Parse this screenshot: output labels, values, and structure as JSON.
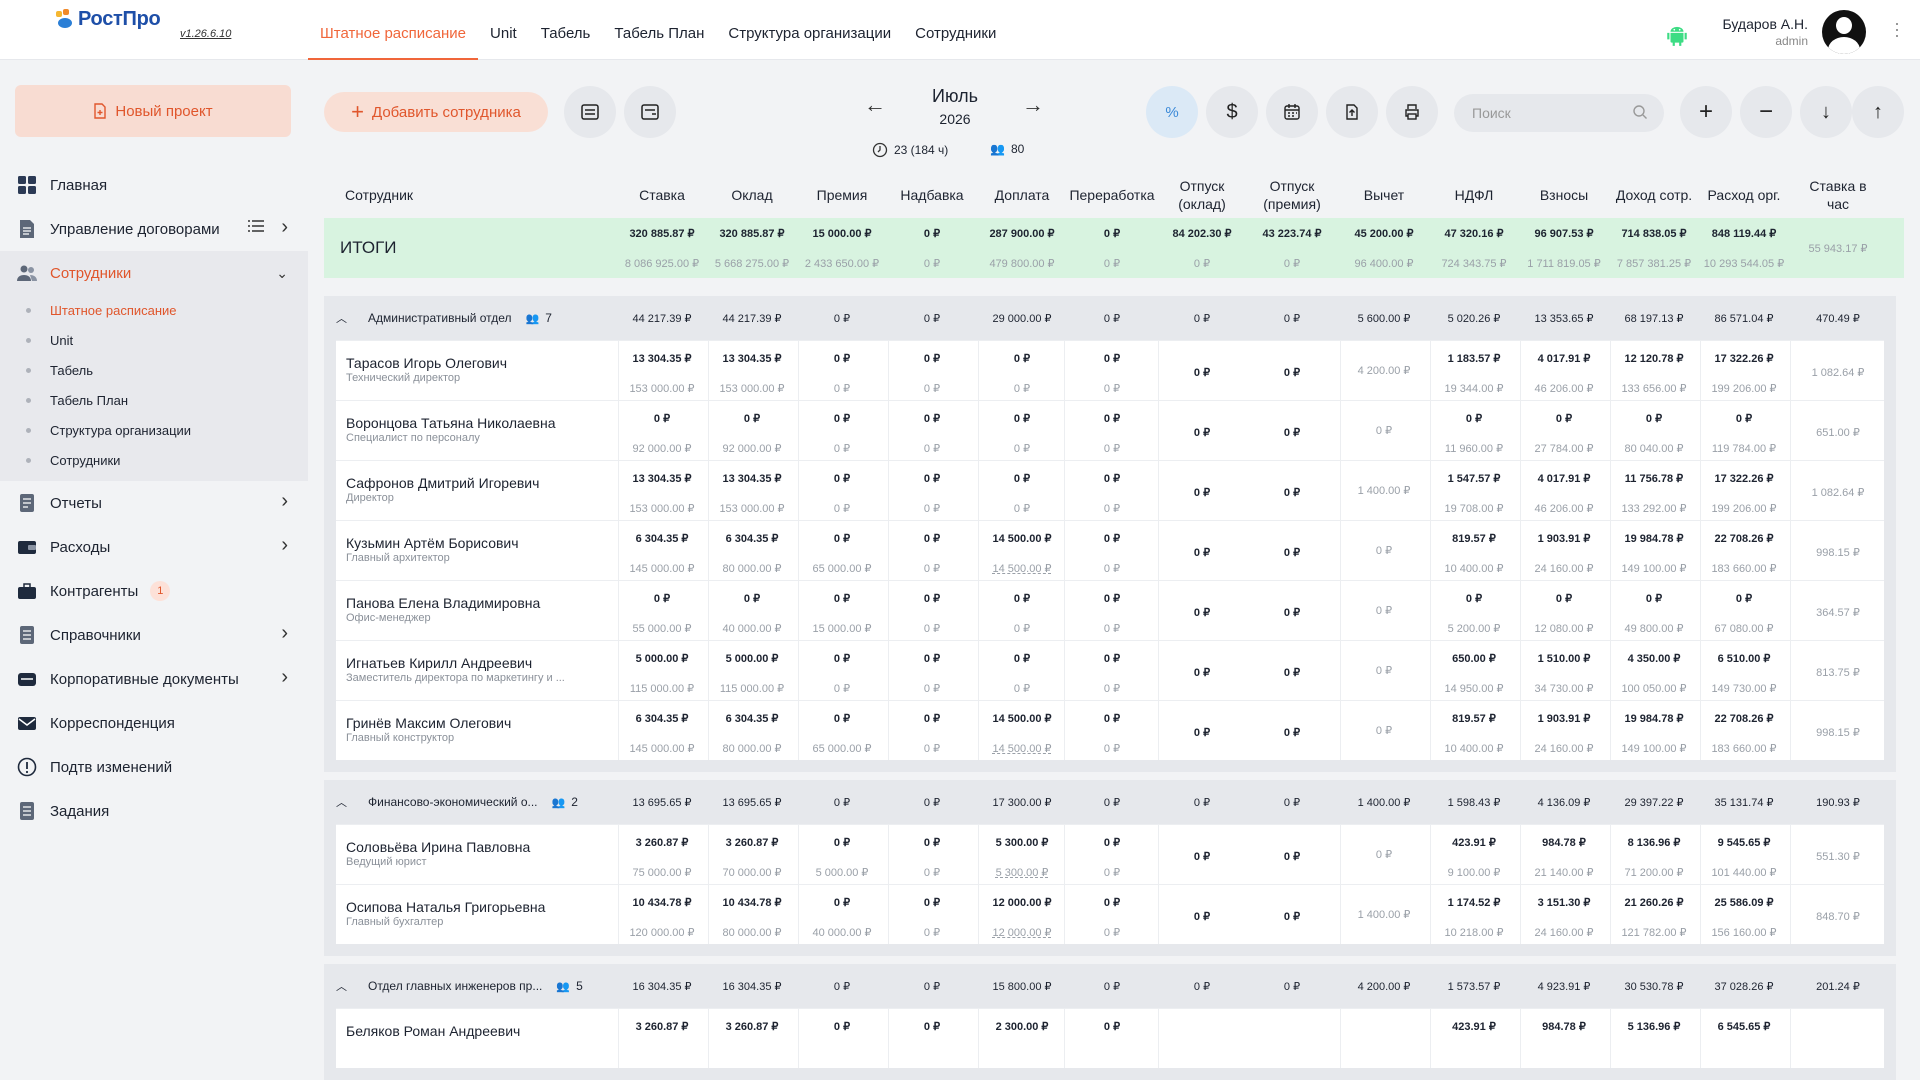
{
  "app": {
    "logo_text": "РостПро",
    "version": "v1.26.6.10"
  },
  "nav": [
    {
      "label": "Штатное расписание",
      "active": true
    },
    {
      "label": "Unit"
    },
    {
      "label": "Табель"
    },
    {
      "label": "Табель План"
    },
    {
      "label": "Структура организации"
    },
    {
      "label": "Сотрудники"
    }
  ],
  "user": {
    "name": "Бударов А.Н.",
    "role": "admin"
  },
  "sidebar": {
    "new_project": "Новый проект",
    "items": [
      {
        "label": "Главная",
        "icon": "grid-icon"
      },
      {
        "label": "Управление договорами",
        "icon": "document-icon"
      },
      {
        "label": "Сотрудники",
        "icon": "users-icon",
        "active": true
      },
      {
        "label": "Отчеты",
        "icon": "report-icon"
      },
      {
        "label": "Расходы",
        "icon": "wallet-icon"
      },
      {
        "label": "Контрагенты",
        "icon": "briefcase-icon",
        "badge": "1"
      },
      {
        "label": "Справочники",
        "icon": "book-icon"
      },
      {
        "label": "Корпоративные документы",
        "icon": "folder-icon"
      },
      {
        "label": "Корреспонденция",
        "icon": "mail-icon"
      },
      {
        "label": "Подтв изменений",
        "icon": "alert-icon"
      },
      {
        "label": "Задания",
        "icon": "tasks-icon"
      }
    ],
    "subitems": [
      {
        "label": "Штатное расписание",
        "active": true
      },
      {
        "label": "Unit"
      },
      {
        "label": "Табель"
      },
      {
        "label": "Табель План"
      },
      {
        "label": "Структура организации"
      },
      {
        "label": "Сотрудники"
      }
    ]
  },
  "toolbar": {
    "add_employee": "Добавить сотрудника",
    "month": "Июль",
    "year": "2026",
    "hours": "23 (184 ч)",
    "people": "80",
    "search_placeholder": "Поиск"
  },
  "columns": [
    "Сотрудник",
    "Ставка",
    "Оклад",
    "Премия",
    "Надбавка",
    "Доплата",
    "Переработка",
    "Отпуск (оклад)",
    "Отпуск (премия)",
    "Вычет",
    "НДФЛ",
    "Взносы",
    "Доход сотр.",
    "Расход орг.",
    "Ставка в час"
  ],
  "totals": {
    "label": "ИТОГИ",
    "top": [
      "320 885.87 ₽",
      "320 885.87 ₽",
      "15 000.00 ₽",
      "0 ₽",
      "287 900.00 ₽",
      "0 ₽",
      "84 202.30 ₽",
      "43 223.74 ₽",
      "45 200.00 ₽",
      "47 320.16 ₽",
      "96 907.53 ₽",
      "714 838.05 ₽",
      "848 119.44 ₽"
    ],
    "bottom": [
      "8 086 925.00 ₽",
      "5 668 275.00 ₽",
      "2 433 650.00 ₽",
      "0 ₽",
      "479 800.00 ₽",
      "0 ₽",
      "0 ₽",
      "0 ₽",
      "96 400.00 ₽",
      "724 343.75 ₽",
      "1 711 819.05 ₽",
      "7 857 381.25 ₽",
      "10 293 544.05 ₽"
    ],
    "hourly": "55 943.17 ₽"
  },
  "departments": [
    {
      "name": "Административный отдел",
      "count": "7",
      "values": [
        "44 217.39 ₽",
        "44 217.39 ₽",
        "0 ₽",
        "0 ₽",
        "29 000.00 ₽",
        "0 ₽",
        "0 ₽",
        "0 ₽",
        "5 600.00 ₽",
        "5 020.26 ₽",
        "13 353.65 ₽",
        "68 197.13 ₽",
        "86 571.04 ₽",
        "470.49 ₽"
      ],
      "employees": [
        {
          "name": "Тарасов Игорь Олегович",
          "position": "Технический директор",
          "top": [
            "13 304.35 ₽",
            "13 304.35 ₽",
            "0 ₽",
            "0 ₽",
            "0 ₽",
            "0 ₽"
          ],
          "bottom": [
            "153 000.00 ₽",
            "153 000.00 ₽",
            "0 ₽",
            "0 ₽",
            "0 ₽",
            "0 ₽"
          ],
          "vac1": "0 ₽",
          "vac2": "0 ₽",
          "deduct": "4 200.00 ₽",
          "top2": [
            "1 183.57 ₽",
            "4 017.91 ₽",
            "12 120.78 ₽",
            "17 322.26 ₽"
          ],
          "bottom2": [
            "19 344.00 ₽",
            "46 206.00 ₽",
            "133 656.00 ₽",
            "199 206.00 ₽"
          ],
          "hourly": "1 082.64 ₽"
        },
        {
          "name": "Воронцова Татьяна Николаевна",
          "position": "Специалист по персоналу",
          "top": [
            "0 ₽",
            "0 ₽",
            "0 ₽",
            "0 ₽",
            "0 ₽",
            "0 ₽"
          ],
          "bottom": [
            "92 000.00 ₽",
            "92 000.00 ₽",
            "0 ₽",
            "0 ₽",
            "0 ₽",
            "0 ₽"
          ],
          "vac1": "0 ₽",
          "vac2": "0 ₽",
          "deduct": "0 ₽",
          "top2": [
            "0 ₽",
            "0 ₽",
            "0 ₽",
            "0 ₽"
          ],
          "bottom2": [
            "11 960.00 ₽",
            "27 784.00 ₽",
            "80 040.00 ₽",
            "119 784.00 ₽"
          ],
          "hourly": "651.00 ₽"
        },
        {
          "name": "Сафронов Дмитрий Игоревич",
          "position": "Директор",
          "top": [
            "13 304.35 ₽",
            "13 304.35 ₽",
            "0 ₽",
            "0 ₽",
            "0 ₽",
            "0 ₽"
          ],
          "bottom": [
            "153 000.00 ₽",
            "153 000.00 ₽",
            "0 ₽",
            "0 ₽",
            "0 ₽",
            "0 ₽"
          ],
          "vac1": "0 ₽",
          "vac2": "0 ₽",
          "deduct": "1 400.00 ₽",
          "top2": [
            "1 547.57 ₽",
            "4 017.91 ₽",
            "11 756.78 ₽",
            "17 322.26 ₽"
          ],
          "bottom2": [
            "19 708.00 ₽",
            "46 206.00 ₽",
            "133 292.00 ₽",
            "199 206.00 ₽"
          ],
          "hourly": "1 082.64 ₽"
        },
        {
          "name": "Кузьмин Артём Борисович",
          "position": "Главный архитектор",
          "top": [
            "6 304.35 ₽",
            "6 304.35 ₽",
            "0 ₽",
            "0 ₽",
            "14 500.00 ₽",
            "0 ₽"
          ],
          "bottom": [
            "145 000.00 ₽",
            "80 000.00 ₽",
            "65 000.00 ₽",
            "0 ₽",
            "14 500.00 ₽",
            "0 ₽"
          ],
          "vac1": "0 ₽",
          "vac2": "0 ₽",
          "deduct": "0 ₽",
          "top2": [
            "819.57 ₽",
            "1 903.91 ₽",
            "19 984.78 ₽",
            "22 708.26 ₽"
          ],
          "bottom2": [
            "10 400.00 ₽",
            "24 160.00 ₽",
            "149 100.00 ₽",
            "183 660.00 ₽"
          ],
          "hourly": "998.15 ₽"
        },
        {
          "name": "Панова Елена Владимировна",
          "position": "Офис-менеджер",
          "top": [
            "0 ₽",
            "0 ₽",
            "0 ₽",
            "0 ₽",
            "0 ₽",
            "0 ₽"
          ],
          "bottom": [
            "55 000.00 ₽",
            "40 000.00 ₽",
            "15 000.00 ₽",
            "0 ₽",
            "0 ₽",
            "0 ₽"
          ],
          "vac1": "0 ₽",
          "vac2": "0 ₽",
          "deduct": "0 ₽",
          "top2": [
            "0 ₽",
            "0 ₽",
            "0 ₽",
            "0 ₽"
          ],
          "bottom2": [
            "5 200.00 ₽",
            "12 080.00 ₽",
            "49 800.00 ₽",
            "67 080.00 ₽"
          ],
          "hourly": "364.57 ₽"
        },
        {
          "name": "Игнатьев Кирилл Андреевич",
          "position": "Заместитель директора по маркетингу и ...",
          "top": [
            "5 000.00 ₽",
            "5 000.00 ₽",
            "0 ₽",
            "0 ₽",
            "0 ₽",
            "0 ₽"
          ],
          "bottom": [
            "115 000.00 ₽",
            "115 000.00 ₽",
            "0 ₽",
            "0 ₽",
            "0 ₽",
            "0 ₽"
          ],
          "vac1": "0 ₽",
          "vac2": "0 ₽",
          "deduct": "0 ₽",
          "top2": [
            "650.00 ₽",
            "1 510.00 ₽",
            "4 350.00 ₽",
            "6 510.00 ₽"
          ],
          "bottom2": [
            "14 950.00 ₽",
            "34 730.00 ₽",
            "100 050.00 ₽",
            "149 730.00 ₽"
          ],
          "hourly": "813.75 ₽"
        },
        {
          "name": "Гринёв Максим Олегович",
          "position": "Главный конструктор",
          "top": [
            "6 304.35 ₽",
            "6 304.35 ₽",
            "0 ₽",
            "0 ₽",
            "14 500.00 ₽",
            "0 ₽"
          ],
          "bottom": [
            "145 000.00 ₽",
            "80 000.00 ₽",
            "65 000.00 ₽",
            "0 ₽",
            "14 500.00 ₽",
            "0 ₽"
          ],
          "vac1": "0 ₽",
          "vac2": "0 ₽",
          "deduct": "0 ₽",
          "top2": [
            "819.57 ₽",
            "1 903.91 ₽",
            "19 984.78 ₽",
            "22 708.26 ₽"
          ],
          "bottom2": [
            "10 400.00 ₽",
            "24 160.00 ₽",
            "149 100.00 ₽",
            "183 660.00 ₽"
          ],
          "hourly": "998.15 ₽"
        }
      ]
    },
    {
      "name": "Финансово-экономический о...",
      "count": "2",
      "values": [
        "13 695.65 ₽",
        "13 695.65 ₽",
        "0 ₽",
        "0 ₽",
        "17 300.00 ₽",
        "0 ₽",
        "0 ₽",
        "0 ₽",
        "1 400.00 ₽",
        "1 598.43 ₽",
        "4 136.09 ₽",
        "29 397.22 ₽",
        "35 131.74 ₽",
        "190.93 ₽"
      ],
      "employees": [
        {
          "name": "Соловьёва Ирина Павловна",
          "position": "Ведущий юрист",
          "top": [
            "3 260.87 ₽",
            "3 260.87 ₽",
            "0 ₽",
            "0 ₽",
            "5 300.00 ₽",
            "0 ₽"
          ],
          "bottom": [
            "75 000.00 ₽",
            "70 000.00 ₽",
            "5 000.00 ₽",
            "0 ₽",
            "5 300.00 ₽",
            "0 ₽"
          ],
          "vac1": "0 ₽",
          "vac2": "0 ₽",
          "deduct": "0 ₽",
          "top2": [
            "423.91 ₽",
            "984.78 ₽",
            "8 136.96 ₽",
            "9 545.65 ₽"
          ],
          "bottom2": [
            "9 100.00 ₽",
            "21 140.00 ₽",
            "71 200.00 ₽",
            "101 440.00 ₽"
          ],
          "hourly": "551.30 ₽"
        },
        {
          "name": "Осипова Наталья Григорьевна",
          "position": "Главный бухгалтер",
          "top": [
            "10 434.78 ₽",
            "10 434.78 ₽",
            "0 ₽",
            "0 ₽",
            "12 000.00 ₽",
            "0 ₽"
          ],
          "bottom": [
            "120 000.00 ₽",
            "80 000.00 ₽",
            "40 000.00 ₽",
            "0 ₽",
            "12 000.00 ₽",
            "0 ₽"
          ],
          "vac1": "0 ₽",
          "vac2": "0 ₽",
          "deduct": "1 400.00 ₽",
          "top2": [
            "1 174.52 ₽",
            "3 151.30 ₽",
            "21 260.26 ₽",
            "25 586.09 ₽"
          ],
          "bottom2": [
            "10 218.00 ₽",
            "24 160.00 ₽",
            "121 782.00 ₽",
            "156 160.00 ₽"
          ],
          "hourly": "848.70 ₽"
        }
      ]
    },
    {
      "name": "Отдел главных инженеров пр...",
      "count": "5",
      "values": [
        "16 304.35 ₽",
        "16 304.35 ₽",
        "0 ₽",
        "0 ₽",
        "15 800.00 ₽",
        "0 ₽",
        "0 ₽",
        "0 ₽",
        "4 200.00 ₽",
        "1 573.57 ₽",
        "4 923.91 ₽",
        "30 530.78 ₽",
        "37 028.26 ₽",
        "201.24 ₽"
      ],
      "employees": [
        {
          "name": "Беляков Роман Андреевич",
          "position": "",
          "top": [
            "3 260.87 ₽",
            "3 260.87 ₽",
            "0 ₽",
            "0 ₽",
            "2 300.00 ₽",
            "0 ₽"
          ],
          "bottom": [],
          "vac1": "",
          "vac2": "",
          "deduct": "",
          "top2": [
            "423.91 ₽",
            "984.78 ₽",
            "5 136.96 ₽",
            "6 545.65 ₽"
          ],
          "bottom2": [],
          "hourly": ""
        }
      ]
    }
  ]
}
